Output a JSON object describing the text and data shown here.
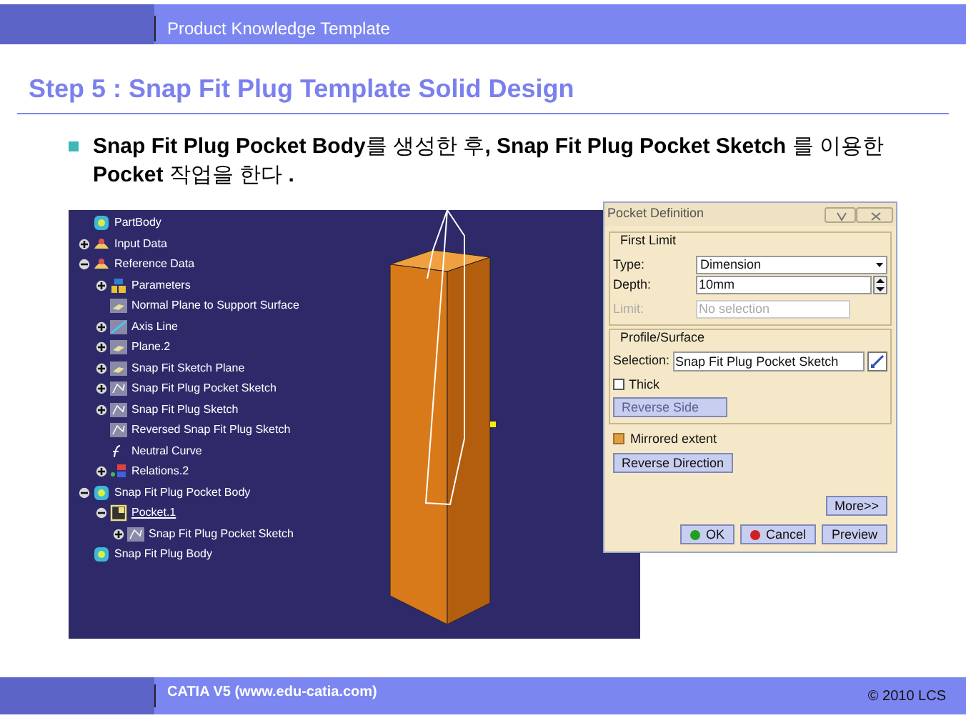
{
  "header": {
    "title": "Product Knowledge Template"
  },
  "slide": {
    "title": "Step 5 : Snap Fit Plug Template Solid Design",
    "bullet": "**Snap Fit Plug Pocket Body**를 생성한 후**,** **Snap Fit Plug Pocket Sketch** 를 이용한 **Pocket** 작업을 한다 **.**"
  },
  "tree": [
    {
      "label": "PartBody",
      "kind": "body",
      "selected": false
    },
    {
      "label": "Input Data",
      "kind": "set",
      "expanded": false,
      "selected": false
    },
    {
      "label": "Reference Data",
      "kind": "set",
      "expanded": true,
      "selected": false,
      "children": [
        {
          "label": "Parameters",
          "kind": "params",
          "expanded": false,
          "selected": false
        },
        {
          "label": "Normal Plane to Support Surface",
          "kind": "plane",
          "selected": false
        },
        {
          "label": "Axis Line",
          "kind": "line",
          "expanded": false,
          "selected": false
        },
        {
          "label": "Plane.2",
          "kind": "plane",
          "expanded": false,
          "selected": false
        },
        {
          "label": "Snap Fit Sketch Plane",
          "kind": "plane",
          "expanded": false,
          "selected": false
        },
        {
          "label": "Snap Fit Plug Pocket Sketch",
          "kind": "sketch",
          "expanded": false,
          "selected": false
        },
        {
          "label": "Snap Fit Plug Sketch",
          "kind": "sketch",
          "expanded": false,
          "selected": false
        },
        {
          "label": "Reversed Snap Fit Plug Sketch",
          "kind": "sketch",
          "selected": false
        },
        {
          "label": "Neutral Curve",
          "kind": "formula",
          "selected": false
        },
        {
          "label": "Relations.2",
          "kind": "relations",
          "expanded": false,
          "selected": false
        }
      ]
    },
    {
      "label": "Snap Fit Plug Pocket Body",
      "kind": "body",
      "expanded": true,
      "selected": false,
      "children": [
        {
          "label": "Pocket.1",
          "kind": "pocket",
          "expanded": true,
          "selected": true,
          "children": [
            {
              "label": "Snap Fit Plug Pocket Sketch",
              "kind": "sketch",
              "expanded": false,
              "selected": false
            }
          ]
        }
      ]
    },
    {
      "label": "Snap Fit Plug Body",
      "kind": "body",
      "selected": false
    }
  ],
  "dialog": {
    "title": "Pocket Definition",
    "first_limit": {
      "title": "First Limit",
      "type_label": "Type:",
      "type_value": "Dimension",
      "depth_label": "Depth:",
      "depth_value": "10mm",
      "limit_label": "Limit:",
      "limit_placeholder": "No selection",
      "limit_disabled": true
    },
    "profile": {
      "title": "Profile/Surface",
      "selection_label": "Selection:",
      "selection_value": "Snap Fit Plug Pocket Sketch",
      "thick_label": "Thick",
      "thick_checked": false,
      "reverse_side": "Reverse Side",
      "reverse_side_disabled": true
    },
    "mirrored_label": "Mirrored extent",
    "mirrored_checked": true,
    "reverse_direction": "Reverse Direction",
    "more": "More>>",
    "buttons": [
      {
        "label": "OK",
        "kind": "ok"
      },
      {
        "label": "Cancel",
        "kind": "cancel"
      },
      {
        "label": "Preview",
        "kind": "plain"
      }
    ]
  },
  "footer": {
    "left": "CATIA V5 (www.edu-catia.com)",
    "right": "© 2010 LCS"
  }
}
